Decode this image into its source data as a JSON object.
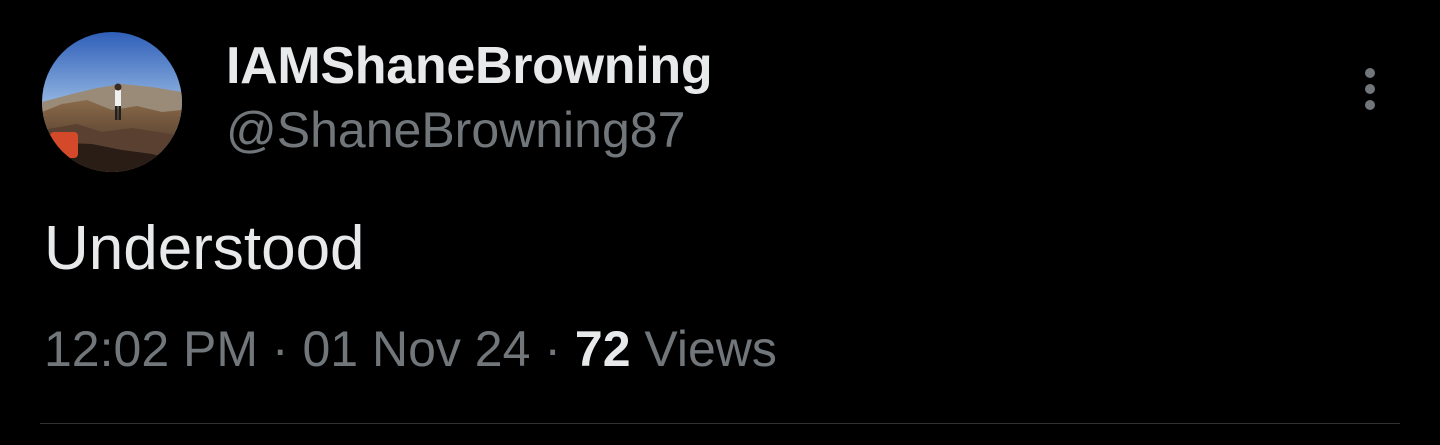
{
  "colors": {
    "background": "#000000",
    "primary_text": "#e7e9ea",
    "secondary_text": "#71767b",
    "divider": "#2f3336"
  },
  "author": {
    "display_name": "IAMShaneBrowning",
    "handle": "@ShaneBrowning87",
    "avatar": "landscape-photo-avatar"
  },
  "more_button": {
    "icon": "more-vertical-icon"
  },
  "tweet": {
    "text": "Understood",
    "time": "12:02 PM",
    "separator": "·",
    "date": "01 Nov 24",
    "views_count": "72",
    "views_label": "Views"
  }
}
